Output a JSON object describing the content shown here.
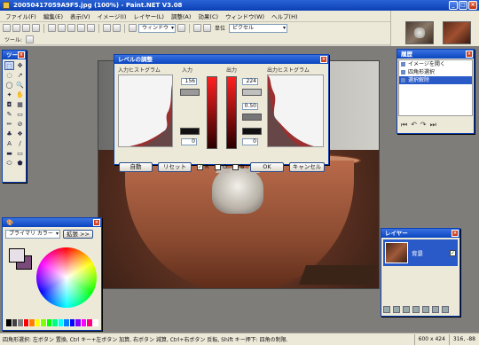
{
  "window": {
    "title": "20050417059A9F5.jpg (100%) - Paint.NET V3.08"
  },
  "menu": [
    "ファイル(F)",
    "編集(E)",
    "表示(V)",
    "イメージ(I)",
    "レイヤー(L)",
    "調整(A)",
    "効果(C)",
    "ウィンドウ(W)",
    "ヘルプ(H)"
  ],
  "toolbar": {
    "window_menu": "ウィンドウ",
    "unit_label": "単位",
    "unit_value": "ピクセル",
    "tool_label": "ツール:"
  },
  "tools_panel": {
    "title": "ツール"
  },
  "history_panel": {
    "title": "履歴",
    "items": [
      "イメージを開く",
      "四角形選択",
      "選択解除"
    ]
  },
  "layers_panel": {
    "title": "レイヤー",
    "layer_name": "背景"
  },
  "colors_panel": {
    "mode": "プライマリ カラー",
    "expand": "拡張 >>",
    "fg_color": "#e8e0e8",
    "bg_color": "#7a4a7a",
    "palette": [
      "#000000",
      "#404040",
      "#808080",
      "#ff0000",
      "#ff8000",
      "#ffff00",
      "#80ff00",
      "#00ff00",
      "#00ff80",
      "#00ffff",
      "#0080ff",
      "#0000ff",
      "#8000ff",
      "#ff00ff",
      "#ff0080",
      "#ffffff"
    ]
  },
  "levels_dialog": {
    "title": "レベルの調整",
    "input_hist_label": "入力ヒストグラム",
    "input_label": "入力",
    "output_label": "出力",
    "output_hist_label": "出力ヒストグラム",
    "input_high": "156",
    "input_low": "0",
    "output_high": "224",
    "output_gamma": "0.50",
    "output_low": "0",
    "auto_btn": "自動",
    "reset_btn": "リセット",
    "ch_r": "R",
    "ch_g": "G",
    "ch_b": "B",
    "ok_btn": "OK",
    "cancel_btn": "キャンセル"
  },
  "status": {
    "message": "四角形選択: 左ボタン 置換, Ctrl キー+左ボタン 加算, 右ボタン 減算, Ctrl+右ボタン 反転, Shift キー押下: 四角の制限.",
    "image_size": "600 x 424",
    "cursor": "316, -88"
  }
}
